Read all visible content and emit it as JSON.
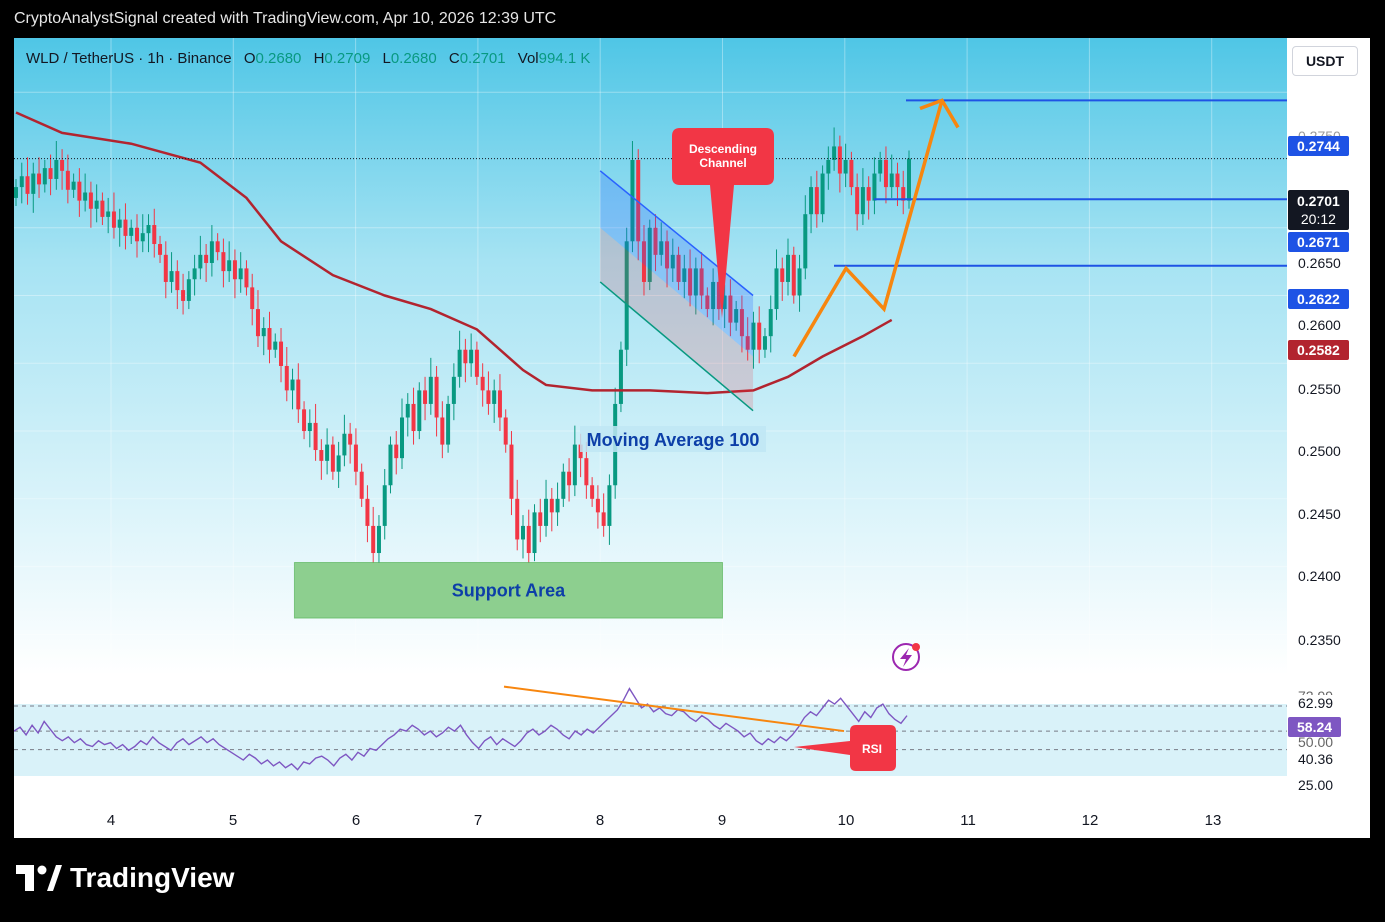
{
  "header": {
    "text": "CryptoAnalystSignal created with TradingView.com, Apr 10, 2026 12:39 UTC"
  },
  "symbol": {
    "name": "WLD / TetherUS · 1h · Binance",
    "open_label": "O",
    "open": "0.2680",
    "high_label": "H",
    "high": "0.2709",
    "low_label": "L",
    "low": "0.2680",
    "close_label": "C",
    "close": "0.2701",
    "vol_label": "Vol",
    "vol": "994.1 K"
  },
  "currency_button": "USDT",
  "price_badges": {
    "target": "0.2744",
    "last": "0.2701",
    "countdown": "20:12",
    "level1": "0.2671",
    "level2": "0.2622",
    "ma": "0.2582"
  },
  "price_axis_ticks": [
    "0.2750",
    "0.2650",
    "0.2600",
    "0.2550",
    "0.2500",
    "0.2450",
    "0.2400",
    "0.2350"
  ],
  "rsi_axis": {
    "top": "72.99",
    "upper": "62.99",
    "value": "58.24",
    "mid": "50.00",
    "lower": "40.36",
    "bottom": "25.00"
  },
  "annotations": {
    "descending_channel": "Descending Channel",
    "moving_average": "Moving Average 100",
    "support_area": "Support Area",
    "rsi": "RSI"
  },
  "footer": {
    "brand": "TradingView"
  },
  "colors": {
    "up": "#089981",
    "down": "#f23645",
    "ma": "#b2242f",
    "level": "#1e53e5",
    "arrow": "#f7860f",
    "rsi": "#7e57c2",
    "support": "#8dcf8f",
    "bg_top": "#4fc6e6"
  },
  "chart_data": {
    "type": "candlestick",
    "symbol": "WLD / TetherUS",
    "interval": "1h",
    "exchange": "Binance",
    "x_ticks": [
      "4",
      "5",
      "6",
      "7",
      "8",
      "9",
      "10",
      "11",
      "12",
      "13"
    ],
    "y_range": [
      0.232,
      0.279
    ],
    "candles_close": [
      0.268,
      0.2688,
      0.2675,
      0.269,
      0.2682,
      0.2694,
      0.2686,
      0.27,
      0.2692,
      0.2678,
      0.2684,
      0.267,
      0.2676,
      0.2664,
      0.267,
      0.2658,
      0.2662,
      0.265,
      0.2656,
      0.2644,
      0.265,
      0.264,
      0.2646,
      0.2652,
      0.2638,
      0.263,
      0.261,
      0.2618,
      0.2604,
      0.2596,
      0.2612,
      0.262,
      0.263,
      0.2624,
      0.264,
      0.2632,
      0.2618,
      0.2626,
      0.2612,
      0.262,
      0.2606,
      0.259,
      0.257,
      0.2576,
      0.256,
      0.2566,
      0.2548,
      0.253,
      0.2538,
      0.2516,
      0.25,
      0.2506,
      0.2486,
      0.2478,
      0.249,
      0.247,
      0.2482,
      0.2498,
      0.249,
      0.247,
      0.245,
      0.243,
      0.241,
      0.243,
      0.246,
      0.249,
      0.248,
      0.251,
      0.252,
      0.25,
      0.253,
      0.252,
      0.254,
      0.251,
      0.249,
      0.252,
      0.254,
      0.256,
      0.255,
      0.256,
      0.254,
      0.253,
      0.252,
      0.253,
      0.251,
      0.249,
      0.245,
      0.242,
      0.243,
      0.241,
      0.244,
      0.243,
      0.245,
      0.244,
      0.245,
      0.247,
      0.246,
      0.249,
      0.248,
      0.246,
      0.245,
      0.244,
      0.243,
      0.246,
      0.252,
      0.256,
      0.264,
      0.27,
      0.264,
      0.261,
      0.265,
      0.263,
      0.264,
      0.262,
      0.263,
      0.261,
      0.262,
      0.26,
      0.262,
      0.26,
      0.259,
      0.261,
      0.259,
      0.26,
      0.258,
      0.259,
      0.257,
      0.256,
      0.258,
      0.256,
      0.257,
      0.259,
      0.262,
      0.261,
      0.263,
      0.26,
      0.262,
      0.266,
      0.268,
      0.266,
      0.269,
      0.27,
      0.271,
      0.269,
      0.27,
      0.268,
      0.266,
      0.268,
      0.267,
      0.269,
      0.27,
      0.268,
      0.269,
      0.268,
      0.267,
      0.2701
    ],
    "ma100_points": [
      [
        0,
        0.2735
      ],
      [
        8,
        0.272
      ],
      [
        20,
        0.2712
      ],
      [
        32,
        0.2698
      ],
      [
        40,
        0.2672
      ],
      [
        46,
        0.264
      ],
      [
        55,
        0.2615
      ],
      [
        64,
        0.26
      ],
      [
        72,
        0.259
      ],
      [
        80,
        0.2575
      ],
      [
        84,
        0.256
      ],
      [
        88,
        0.2545
      ],
      [
        92,
        0.2534
      ],
      [
        100,
        0.253
      ],
      [
        110,
        0.253
      ],
      [
        120,
        0.2528
      ],
      [
        128,
        0.253
      ],
      [
        134,
        0.254
      ],
      [
        140,
        0.2555
      ],
      [
        147,
        0.257
      ],
      [
        152,
        0.2582
      ]
    ],
    "descending_channel": {
      "upper": [
        [
          0.2692,
          "8"
        ],
        [
          0.26,
          "9.25"
        ]
      ],
      "lower": [
        [
          0.261,
          "8"
        ],
        [
          0.2515,
          "9.25"
        ]
      ]
    },
    "support_area": [
      0.2362,
      0.2403
    ],
    "horizontal_levels": [
      0.2744,
      0.2671,
      0.2622
    ],
    "projection_path": [
      [
        0.2555
      ],
      [
        0.262
      ],
      [
        0.259
      ],
      [
        0.2744
      ]
    ],
    "rsi": {
      "levels": [
        62.99,
        50.0,
        40.36
      ],
      "current": 58.24,
      "axis_labels": [
        72.99,
        62.99,
        58.24,
        50.0,
        40.36,
        25.0
      ],
      "values": [
        50,
        52,
        48,
        53,
        49,
        55,
        51,
        47,
        45,
        47,
        44,
        46,
        43,
        42,
        45,
        43,
        44,
        41,
        43,
        40,
        42,
        45,
        43,
        47,
        44,
        42,
        40,
        44,
        46,
        43,
        45,
        47,
        44,
        46,
        43,
        41,
        39,
        37,
        35,
        38,
        36,
        33,
        35,
        32,
        34,
        31,
        33,
        30,
        34,
        33,
        36,
        37,
        35,
        32,
        36,
        38,
        35,
        39,
        37,
        41,
        40,
        43,
        46,
        48,
        51,
        50,
        53,
        51,
        48,
        50,
        47,
        49,
        52,
        50,
        53,
        48,
        44,
        41,
        45,
        47,
        43,
        46,
        44,
        42,
        45,
        49,
        51,
        48,
        50,
        53,
        51,
        48,
        46,
        50,
        48,
        51,
        49,
        52,
        55,
        58,
        61,
        66,
        72,
        67,
        62,
        64,
        60,
        62,
        59,
        58,
        61,
        60,
        57,
        55,
        58,
        56,
        53,
        51,
        54,
        52,
        50,
        47,
        49,
        45,
        43,
        46,
        44,
        47,
        45,
        48,
        52,
        57,
        60,
        58,
        62,
        66,
        64,
        67,
        63,
        59,
        55,
        60,
        57,
        62,
        64,
        59,
        56,
        54,
        58
      ],
      "divergence_line": [
        [
          70,
          73
        ],
        [
          139,
          50
        ]
      ]
    }
  }
}
